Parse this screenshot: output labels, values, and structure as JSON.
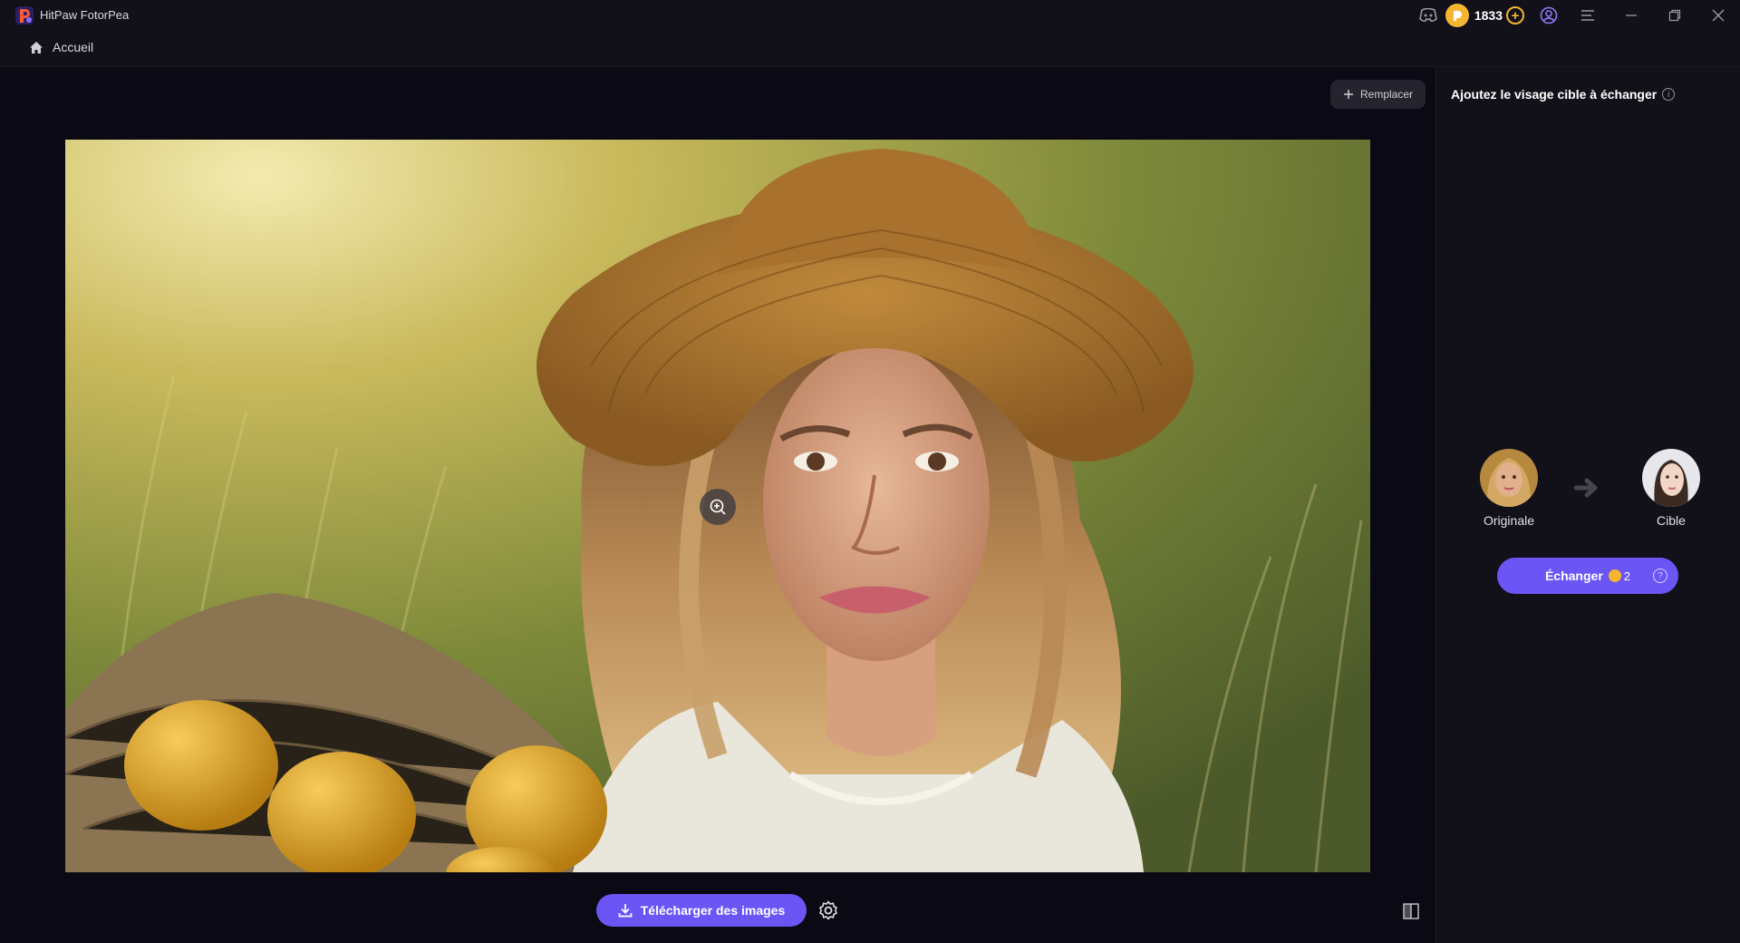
{
  "window": {
    "app_title": "HitPaw FotorPea",
    "coin_count": "1833",
    "coin_add_symbol": "+"
  },
  "nav": {
    "home_label": "Accueil"
  },
  "workspace": {
    "replace_label": "Remplacer",
    "download_label": "Télécharger des images"
  },
  "panel": {
    "title": "Ajoutez le visage cible à échanger",
    "info_symbol": "i",
    "original_label": "Originale",
    "target_label": "Cible",
    "swap_label": "Échanger",
    "swap_cost": "2",
    "swap_help_symbol": "?"
  },
  "colors": {
    "accent": "#6b55f5",
    "coin": "#f5b531",
    "background": "#0b0a14",
    "panel": "#121119"
  },
  "icons": [
    "app-logo-icon",
    "discord-icon",
    "coin-icon",
    "add-coins-icon",
    "account-icon",
    "menu-icon",
    "minimize-icon",
    "maximize-icon",
    "close-icon",
    "home-icon",
    "plus-icon",
    "zoom-in-icon",
    "download-icon",
    "settings-icon",
    "compare-icon",
    "info-icon",
    "arrow-right-icon",
    "help-icon"
  ]
}
